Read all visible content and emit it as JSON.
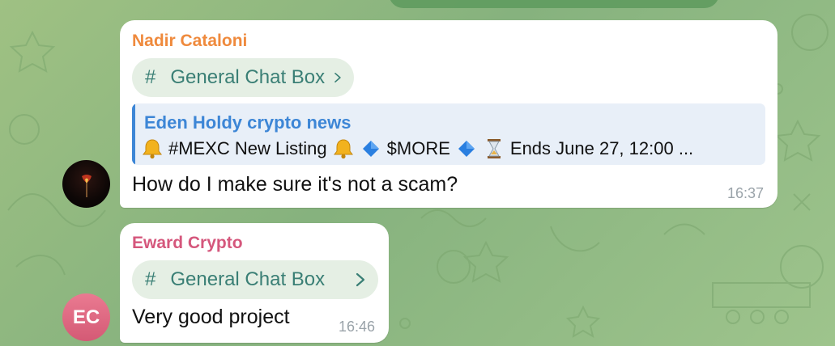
{
  "messages": [
    {
      "sender": "Nadir Cataloni",
      "topic": {
        "hash": "#",
        "label": "General Chat Box"
      },
      "reply": {
        "title": "Eden Holdy crypto news",
        "parts": [
          "#MEXC New Listing",
          "$MORE",
          "Ends June 27, 12:00 ..."
        ]
      },
      "text": "How do I make sure it's not a scam?",
      "time": "16:37"
    },
    {
      "sender": "Eward Crypto",
      "avatar_initials": "EC",
      "topic": {
        "hash": "#",
        "label": "General Chat Box"
      },
      "text": "Very good project",
      "time": "16:46"
    }
  ],
  "icons": {
    "reply_glyphs": [
      "bell-icon",
      "blue-diamond-icon",
      "hourglass-icon"
    ],
    "topic": "hash-icon",
    "chevron": "chevron-right-icon"
  },
  "colors": {
    "sender_1": "#ef8a3d",
    "sender_2": "#d5577c",
    "reply_accent": "#3d86d6",
    "topic_text": "#3a7f75",
    "avatar_ec": "#e06b84"
  }
}
